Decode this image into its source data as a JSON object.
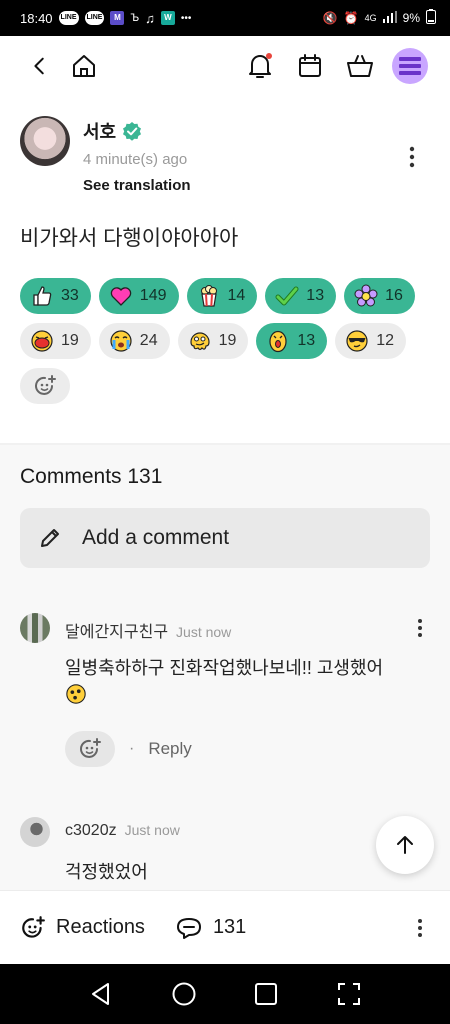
{
  "status_bar": {
    "time": "18:40",
    "battery": "9%",
    "network": "4G"
  },
  "post": {
    "author": "서호",
    "time": "4 minute(s) ago",
    "translate_label": "See translation",
    "text": "비가와서 다행이야아아아"
  },
  "reactions": {
    "row1": [
      {
        "icon": "thumbs-up",
        "count": "33"
      },
      {
        "icon": "heart",
        "count": "149"
      },
      {
        "icon": "popcorn",
        "count": "14"
      },
      {
        "icon": "checkmark",
        "count": "13"
      },
      {
        "icon": "flower",
        "count": "16"
      }
    ],
    "row2": [
      {
        "icon": "laughing-face",
        "count": "19"
      },
      {
        "icon": "crying-face",
        "count": "24"
      },
      {
        "icon": "melting-face",
        "count": "19"
      },
      {
        "icon": "surprised-face",
        "count": "13"
      },
      {
        "icon": "cool-face",
        "count": "12"
      }
    ]
  },
  "comments": {
    "title": "Comments 131",
    "add_placeholder": "Add a comment",
    "items": [
      {
        "name": "달에간지구친구",
        "time": "Just now",
        "text": "일병축하하구 진화작업했나보네!! 고생했어",
        "reply_label": "Reply"
      },
      {
        "name": "c3020z",
        "time": "Just now",
        "text": "걱정했었어"
      }
    ]
  },
  "bottom_bar": {
    "reactions_label": "Reactions",
    "comments_count": "131"
  },
  "colors": {
    "accent": "#3ab694",
    "menu": "#c9a6ff",
    "notif_dot": "#e8453c"
  }
}
